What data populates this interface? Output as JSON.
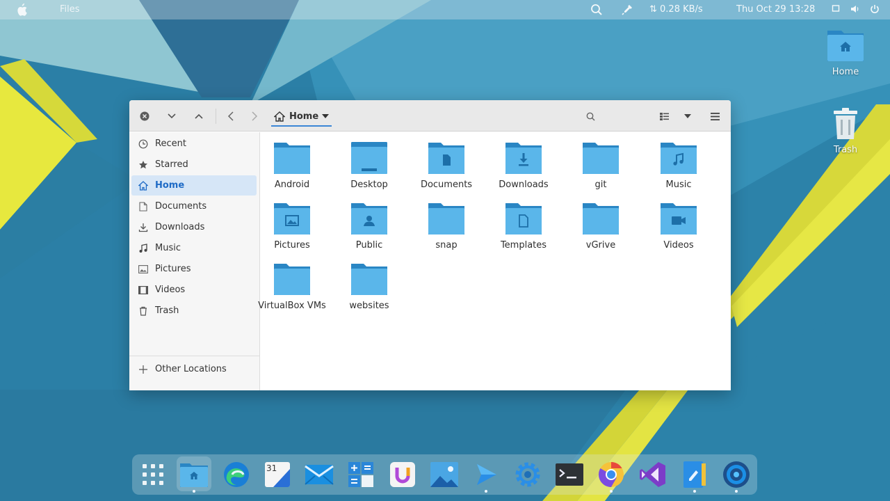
{
  "topbar": {
    "app_name": "Files",
    "net_speed": "⇅ 0.28 KB/s",
    "clock": "Thu Oct 29  13:28"
  },
  "desktop": {
    "home_label": "Home",
    "trash_label": "Trash"
  },
  "window": {
    "path_label": "Home",
    "sidebar": {
      "items": [
        {
          "label": "Recent",
          "icon": "clock-icon"
        },
        {
          "label": "Starred",
          "icon": "star-icon"
        },
        {
          "label": "Home",
          "icon": "home-icon",
          "active": true
        },
        {
          "label": "Documents",
          "icon": "document-icon"
        },
        {
          "label": "Downloads",
          "icon": "download-icon"
        },
        {
          "label": "Music",
          "icon": "music-icon"
        },
        {
          "label": "Pictures",
          "icon": "picture-icon"
        },
        {
          "label": "Videos",
          "icon": "video-icon"
        },
        {
          "label": "Trash",
          "icon": "trash-icon"
        }
      ],
      "other_locations": "Other Locations"
    },
    "files": [
      {
        "name": "Android",
        "icon": "folder-icon"
      },
      {
        "name": "Desktop",
        "icon": "desktop-folder-icon"
      },
      {
        "name": "Documents",
        "icon": "documents-folder-icon"
      },
      {
        "name": "Downloads",
        "icon": "downloads-folder-icon"
      },
      {
        "name": "git",
        "icon": "folder-icon"
      },
      {
        "name": "Music",
        "icon": "music-folder-icon"
      },
      {
        "name": "Pictures",
        "icon": "pictures-folder-icon"
      },
      {
        "name": "Public",
        "icon": "public-folder-icon"
      },
      {
        "name": "snap",
        "icon": "folder-icon"
      },
      {
        "name": "Templates",
        "icon": "templates-folder-icon"
      },
      {
        "name": "vGrive",
        "icon": "folder-icon"
      },
      {
        "name": "Videos",
        "icon": "videos-folder-icon"
      },
      {
        "name": "VirtualBox VMs",
        "icon": "folder-icon"
      },
      {
        "name": "websites",
        "icon": "folder-icon"
      }
    ]
  },
  "dock": {
    "apps": [
      "show-apps-icon",
      "files-icon",
      "edge-browser-icon",
      "calendar-icon",
      "mail-icon",
      "calculator-icon",
      "ulauncher-icon",
      "image-viewer-icon",
      "play-arrow-icon",
      "settings-gear-icon",
      "terminal-icon",
      "chrome-canary-icon",
      "visual-studio-icon",
      "text-editor-icon",
      "disk-usage-icon"
    ],
    "calendar_day": "31"
  },
  "colors": {
    "accent": "#3b86d6",
    "folder_light": "#5ab6ea",
    "folder_dark": "#2a86c4",
    "sidebar_active_bg": "#d6e6f7"
  }
}
